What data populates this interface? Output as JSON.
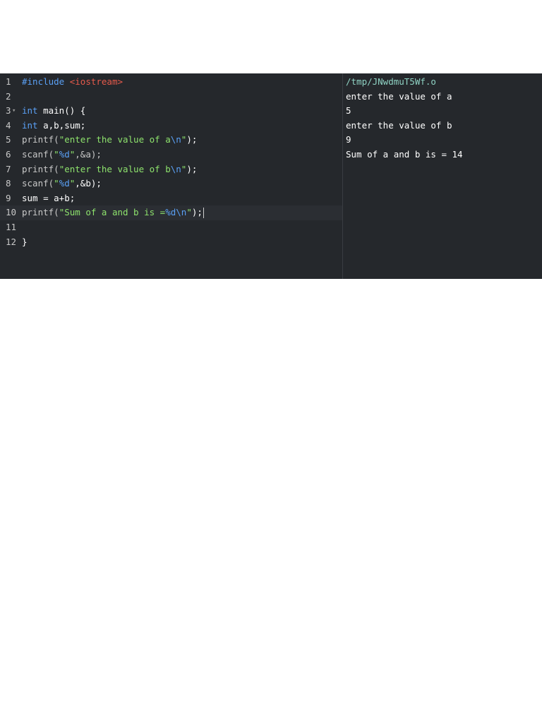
{
  "editor": {
    "lines": [
      {
        "num": "1",
        "t": {
          "a": "#include",
          "b": " ",
          "c": "<iostream>"
        }
      },
      {
        "num": "2"
      },
      {
        "num": "3",
        "fold": "▾",
        "t": {
          "a": "int",
          "b": " main() {"
        }
      },
      {
        "num": "4",
        "t": {
          "a": "int",
          "b": " a,b,sum;"
        }
      },
      {
        "num": "5",
        "t": {
          "a": "printf(",
          "b": "\"enter the value of a",
          "c": "\\n",
          "d": "\"",
          "e": ");"
        }
      },
      {
        "num": "6",
        "t": {
          "a": "scanf(",
          "b": "\"",
          "c": "%d",
          "d": "\"",
          "e": ",&a);"
        }
      },
      {
        "num": "7",
        "t": {
          "a": "printf(",
          "b": "\"enter the value of b",
          "c": "\\n",
          "d": "\"",
          "e": ");"
        }
      },
      {
        "num": "8",
        "t": {
          "a": "scanf(",
          "b": "\"",
          "c": "%d",
          "d": "\"",
          "e": ",&b);"
        }
      },
      {
        "num": "9",
        "t": {
          "a": "sum = a+b;"
        }
      },
      {
        "num": "10",
        "t": {
          "a": "printf(",
          "b": "\"Sum of a and b is =",
          "c": "%d\\n",
          "d": "\"",
          "e": ");"
        }
      },
      {
        "num": "11"
      },
      {
        "num": "12",
        "t": {
          "a": "}"
        }
      }
    ]
  },
  "output": {
    "path": "/tmp/JNwdmuT5Wf.o",
    "lines": [
      "enter the value of a",
      "5",
      "enter the value of b",
      "9",
      "Sum of a and b is = 14"
    ]
  },
  "colors": {
    "background": "#25282c",
    "keyword": "#5aa0f5",
    "string": "#8ee36d",
    "include": "#e65a4b",
    "path": "#8fd3c4"
  }
}
